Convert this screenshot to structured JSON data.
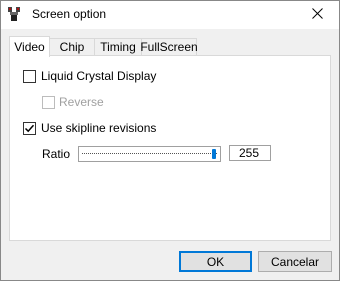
{
  "window": {
    "title": "Screen option"
  },
  "icons": {
    "app": "joystick-app-icon",
    "close": "close-icon"
  },
  "tabs": [
    {
      "label": "Video",
      "active": true
    },
    {
      "label": "Chip",
      "active": false
    },
    {
      "label": "Timing",
      "active": false
    },
    {
      "label": "FullScreen",
      "active": false
    }
  ],
  "video": {
    "lcd": {
      "label": "Liquid Crystal Display",
      "checked": false
    },
    "reverse": {
      "label": "Reverse",
      "checked": false,
      "disabled": true
    },
    "skipline": {
      "label": "Use skipline revisions",
      "checked": true
    },
    "ratio": {
      "label": "Ratio",
      "value": "255",
      "fraction": 1.0
    }
  },
  "buttons": {
    "ok": "OK",
    "cancel": "Cancelar"
  },
  "colors": {
    "accent": "#0078d7"
  }
}
